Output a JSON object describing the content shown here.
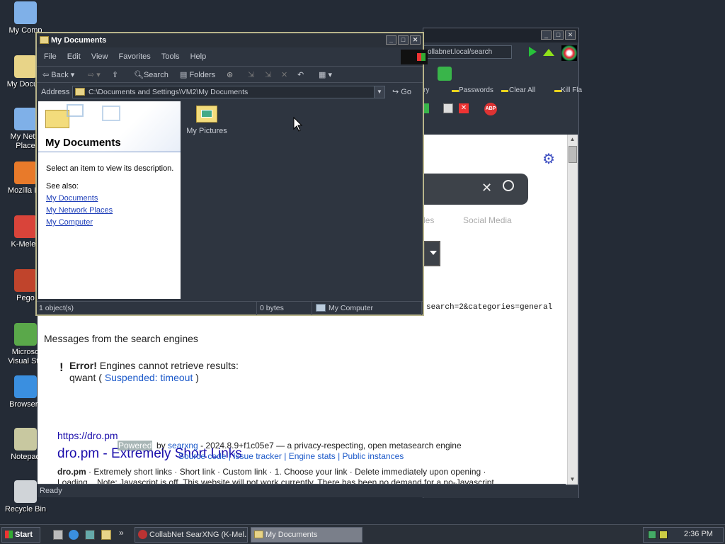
{
  "desktop": {
    "icons": [
      {
        "label": "My Comp",
        "name": "desktop-icon-my-computer"
      },
      {
        "label": "My Docum",
        "name": "desktop-icon-my-documents"
      },
      {
        "label": "My Netw\nPlace",
        "name": "desktop-icon-network-places"
      },
      {
        "label": "Mozilla Fir",
        "name": "desktop-icon-firefox"
      },
      {
        "label": "K-Meleo",
        "name": "desktop-icon-kmeleon"
      },
      {
        "label": "Pego",
        "name": "desktop-icon-pego"
      },
      {
        "label": "Microso\nVisual Stu",
        "name": "desktop-icon-visual-studio"
      },
      {
        "label": "Browserv",
        "name": "desktop-icon-browserver"
      },
      {
        "label": "Notepad",
        "name": "desktop-icon-notepad"
      },
      {
        "label": "Recycle Bin",
        "name": "desktop-icon-recycle-bin"
      }
    ]
  },
  "browser": {
    "url_fragment": "collabnet.local/search",
    "bookmarks": [
      "ry",
      "Passwords",
      "Clear All",
      "Kill Fla"
    ],
    "tabs_visible": [
      "les",
      "Social Media"
    ],
    "query_fragment": "search=2&categories=general",
    "messages_heading": "Messages from the search engines",
    "error_label": "Error!",
    "error_text": "Engines cannot retrieve results:",
    "engine_name": "qwant",
    "engine_status": "Suspended: timeout",
    "result_url": "https://dro.pm",
    "result_title": "dro.pm - Extremely Short Links",
    "result_snippet_bold": "dro.pm",
    "result_snippet": " · Extremely short links · Short link · Custom link · 1. Choose your link · Delete immediately upon opening ·",
    "result_snippet2": "Loading... Note: Javascript is off. This website will not work currently. There has been no demand for a no-Javascript",
    "powered_label": "Powered",
    "powered_by": "by",
    "searxng_link": "searxng",
    "version_text": "- 2024.8.9+f1c05e7 — a privacy-respecting, open metasearch engine",
    "footer_links": [
      "Source code",
      "Issue tracker",
      "Engine stats",
      "Public instances"
    ],
    "status": "Ready"
  },
  "explorer": {
    "title": "My Documents",
    "menu": [
      "File",
      "Edit",
      "View",
      "Favorites",
      "Tools",
      "Help"
    ],
    "toolbar": {
      "back": "Back",
      "search": "Search",
      "folders": "Folders"
    },
    "address_label": "Address",
    "address_value": "C:\\Documents and Settings\\VM2\\My Documents",
    "go_label": "Go",
    "left_title": "My Documents",
    "description_hint": "Select an item to view its description.",
    "see_also": "See also:",
    "see_also_links": [
      "My Documents",
      "My Network Places",
      "My Computer"
    ],
    "items": [
      {
        "label": "My Pictures"
      }
    ],
    "status": {
      "objects": "1 object(s)",
      "size": "0 bytes",
      "location": "My Computer"
    }
  },
  "taskbar": {
    "start": "Start",
    "tasks": [
      "CollabNet SearXNG (K-Mel...",
      "My Documents"
    ],
    "clock": "2:36 PM"
  },
  "colors": {
    "desktop": "#242b36",
    "link": "#1a0dab",
    "explorer_border": "#b8b48a"
  }
}
